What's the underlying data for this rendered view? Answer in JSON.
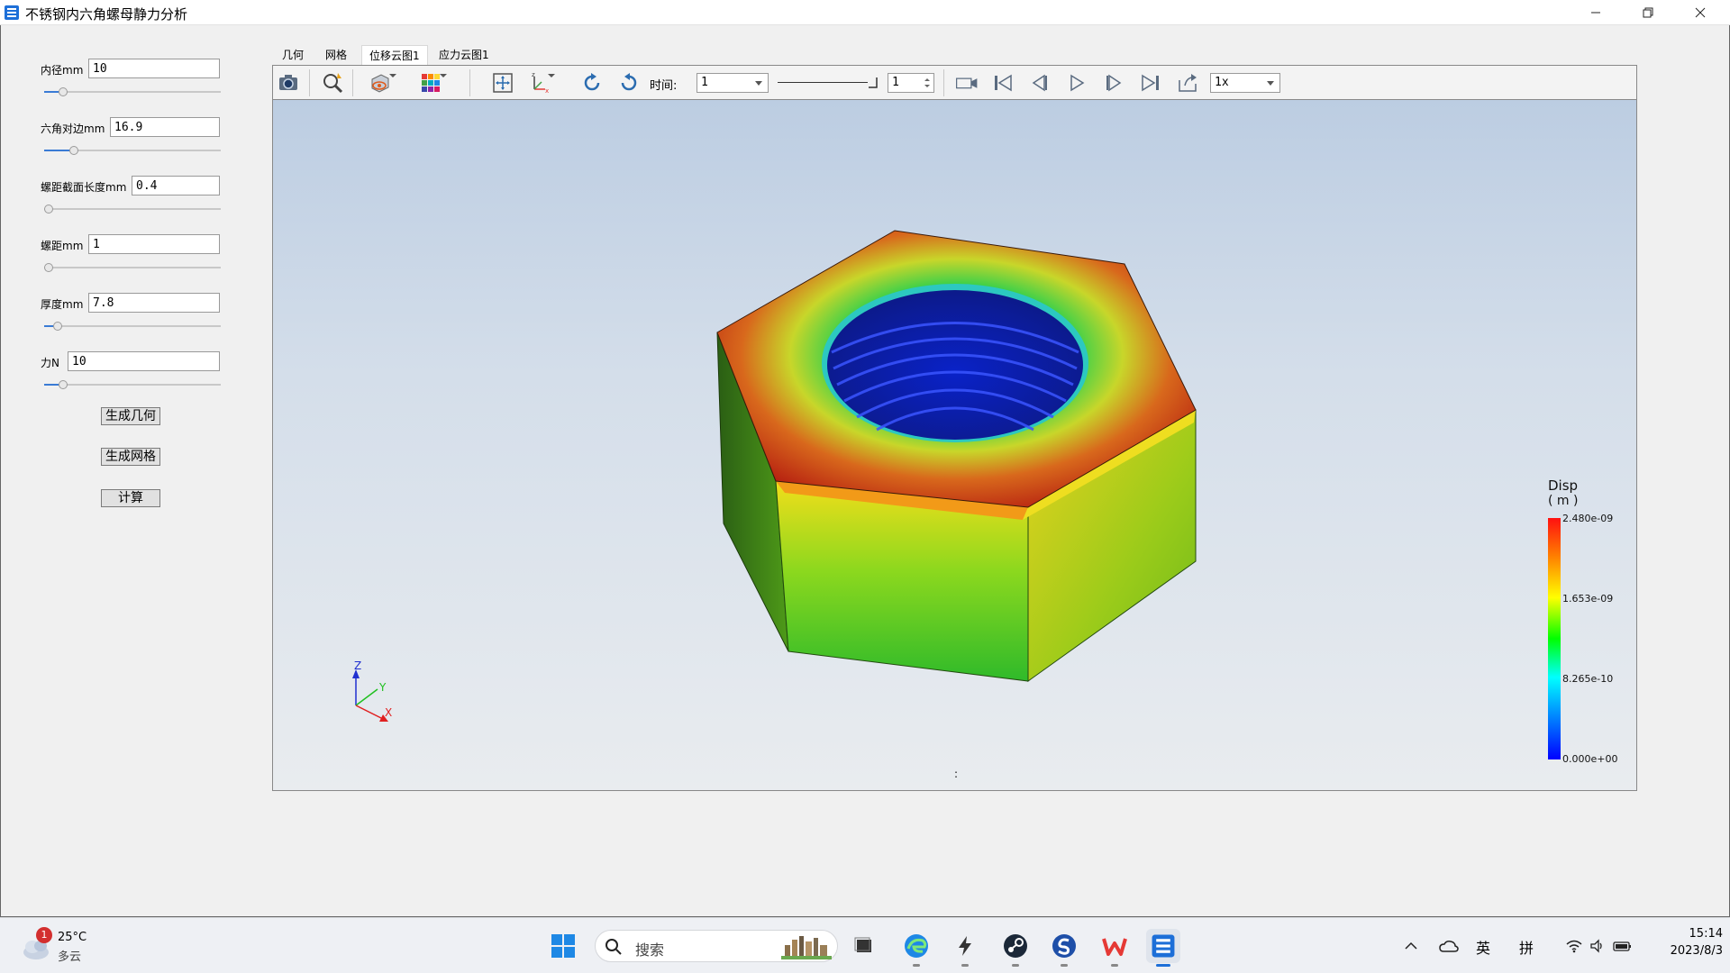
{
  "window": {
    "title": "不锈钢内六角螺母静力分析",
    "controls": [
      "minimize",
      "restore",
      "close"
    ]
  },
  "params": [
    {
      "label": "内径mm",
      "value": "10",
      "slider": 0.1
    },
    {
      "label": "六角对边mm",
      "value": "16.9",
      "slider": 0.16
    },
    {
      "label": "螺距截面长度mm",
      "value": "0.4",
      "slider": 0.0
    },
    {
      "label": "螺距mm",
      "value": "1",
      "slider": 0.0
    },
    {
      "label": "厚度mm",
      "value": "7.8",
      "slider": 0.06
    },
    {
      "label": "力N",
      "value": "10",
      "slider": 0.1
    }
  ],
  "buttons": {
    "gen_geometry": "生成几何",
    "gen_mesh": "生成网格",
    "compute": "计算"
  },
  "tabs": [
    {
      "label": "几何",
      "active": false
    },
    {
      "label": "网格",
      "active": false
    },
    {
      "label": "位移云图1",
      "active": true
    },
    {
      "label": "应力云图1",
      "active": false
    }
  ],
  "toolbar": {
    "time_label": "时间:",
    "time_value": "1",
    "frame_value": "1",
    "speed_value": "1x"
  },
  "legend": {
    "title": "Disp",
    "unit": "( m )",
    "ticks": [
      "2.480e-09",
      "1.653e-09",
      "8.265e-10",
      "0.000e+00"
    ]
  },
  "axes": {
    "z": "Z",
    "y": "Y",
    "x": "X"
  },
  "viewport_note": ":",
  "taskbar": {
    "weather_temp": "25°C",
    "weather_desc": "多云",
    "weather_badge": "1",
    "search_placeholder": "搜索",
    "ime_lang": "英",
    "ime_mode": "拼",
    "time": "15:14",
    "date": "2023/8/3"
  }
}
